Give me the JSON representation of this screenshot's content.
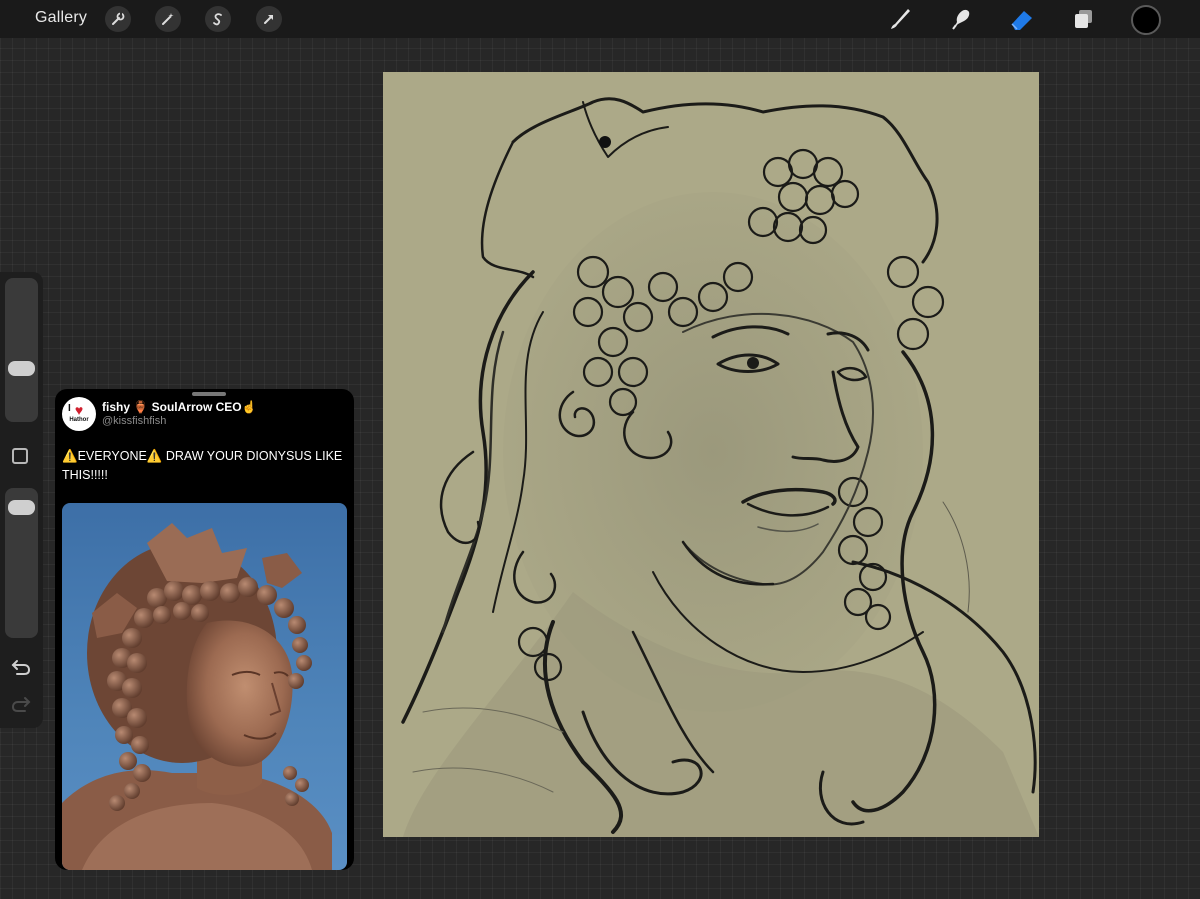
{
  "toolbar": {
    "gallery_label": "Gallery",
    "left_tools": [
      "wrench-icon",
      "magic-wand-icon",
      "selection-s-icon",
      "transform-arrow-icon"
    ],
    "right_tools": [
      "brush-icon",
      "smudge-icon",
      "eraser-icon",
      "layers-icon"
    ],
    "active_tool": "eraser-icon",
    "active_color": "#000000",
    "accent_color": "#1f7ae8"
  },
  "sidebar": {
    "brush_size_level": 0.35,
    "opacity_level": 0.94,
    "icons": [
      "modify-square-icon",
      "undo-icon",
      "redo-icon"
    ]
  },
  "reference": {
    "display_name": "fishy 🏺 SoulArrow CEO☝️",
    "handle": "@kissfishfish",
    "avatar_text_top": "I",
    "avatar_text_bottom": "Hathor",
    "tweet_text": "⚠️EVERYONE⚠️ DRAW YOUR DIONYSUS LIKE THIS!!!!!"
  },
  "canvas": {
    "background_color": "#aca988"
  }
}
